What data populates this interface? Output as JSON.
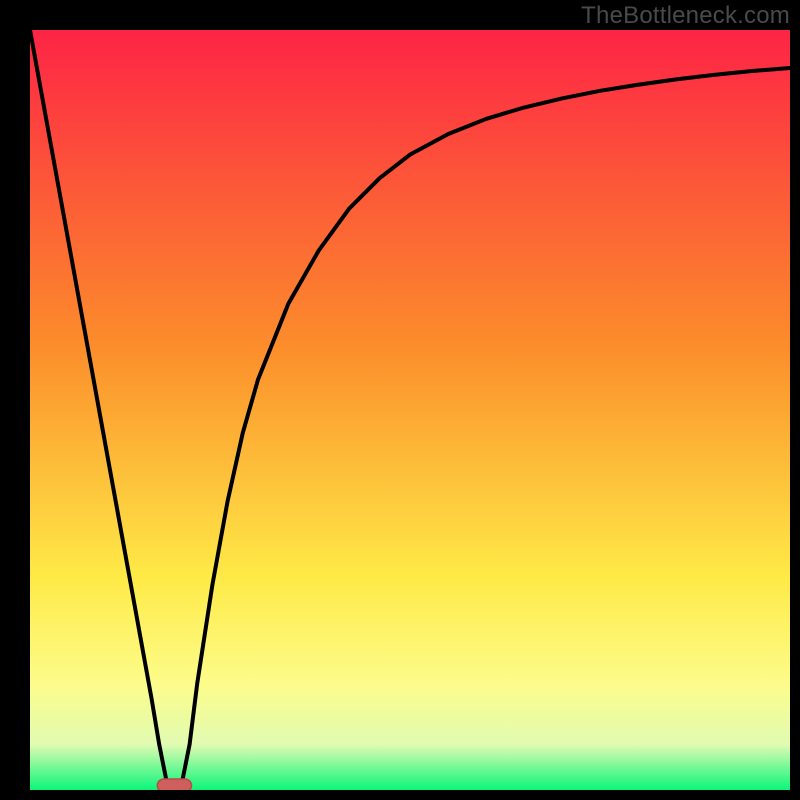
{
  "watermark": "TheBottleneck.com",
  "colors": {
    "frame": "#000000",
    "grad_top": "#fd2445",
    "grad_mid1": "#fc8e2b",
    "grad_mid2": "#feea47",
    "grad_mid3": "#fdfc8a",
    "grad_mid4": "#e1fbb2",
    "grad_bottom": "#0bf67a",
    "curve": "#000000",
    "blob_fill": "#cf5f5c",
    "blob_stroke": "#b74c49"
  },
  "chart_data": {
    "type": "line",
    "title": "",
    "xlabel": "",
    "ylabel": "",
    "xlim": [
      0,
      100
    ],
    "ylim": [
      0,
      100
    ],
    "x": [
      0,
      2,
      4,
      6,
      8,
      10,
      12,
      14,
      16,
      17,
      18,
      19,
      20,
      21,
      22,
      24,
      26,
      28,
      30,
      34,
      38,
      42,
      46,
      50,
      55,
      60,
      65,
      70,
      75,
      80,
      85,
      90,
      95,
      100
    ],
    "values": [
      100,
      89,
      78,
      67,
      56,
      45,
      34,
      23,
      12,
      6,
      1,
      0,
      1,
      6,
      14,
      27,
      38,
      47,
      54,
      64,
      71,
      76.5,
      80.5,
      83.6,
      86.3,
      88.3,
      89.8,
      91,
      92,
      92.8,
      93.5,
      94.1,
      94.6,
      95
    ],
    "optimum_marker": {
      "x_center": 19,
      "width": 4.5,
      "y": 0
    }
  }
}
